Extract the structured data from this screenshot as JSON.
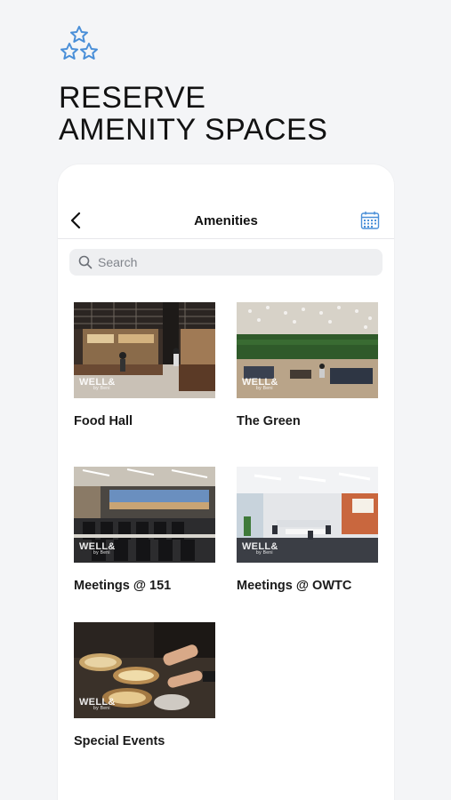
{
  "hero": {
    "icon": "three-stars-icon",
    "line1": "RESERVE",
    "line2": "AMENITY SPACES"
  },
  "nav": {
    "title": "Amenities",
    "back_icon": "chevron-left-icon",
    "calendar_icon": "calendar-icon"
  },
  "search": {
    "placeholder": "Search",
    "value": ""
  },
  "amenities": [
    {
      "name": "Food Hall",
      "image": "food-hall-photo",
      "badge": "WELL&",
      "badge_sub": "by Beni"
    },
    {
      "name": "The Green",
      "image": "green-lounge-photo",
      "badge": "WELL&",
      "badge_sub": "by Beni"
    },
    {
      "name": "Meetings @ 151",
      "image": "meeting-room-photo",
      "badge": "WELL&",
      "badge_sub": "by Beni"
    },
    {
      "name": "Meetings @ OWTC",
      "image": "conference-room-photo",
      "badge": "WELL&",
      "badge_sub": "by Beni"
    },
    {
      "name": "Special Events",
      "image": "catering-photo",
      "badge": "WELL&",
      "badge_sub": "by Beni"
    }
  ],
  "colors": {
    "background": "#f4f5f7",
    "accent_blue": "#4a8fd8"
  }
}
